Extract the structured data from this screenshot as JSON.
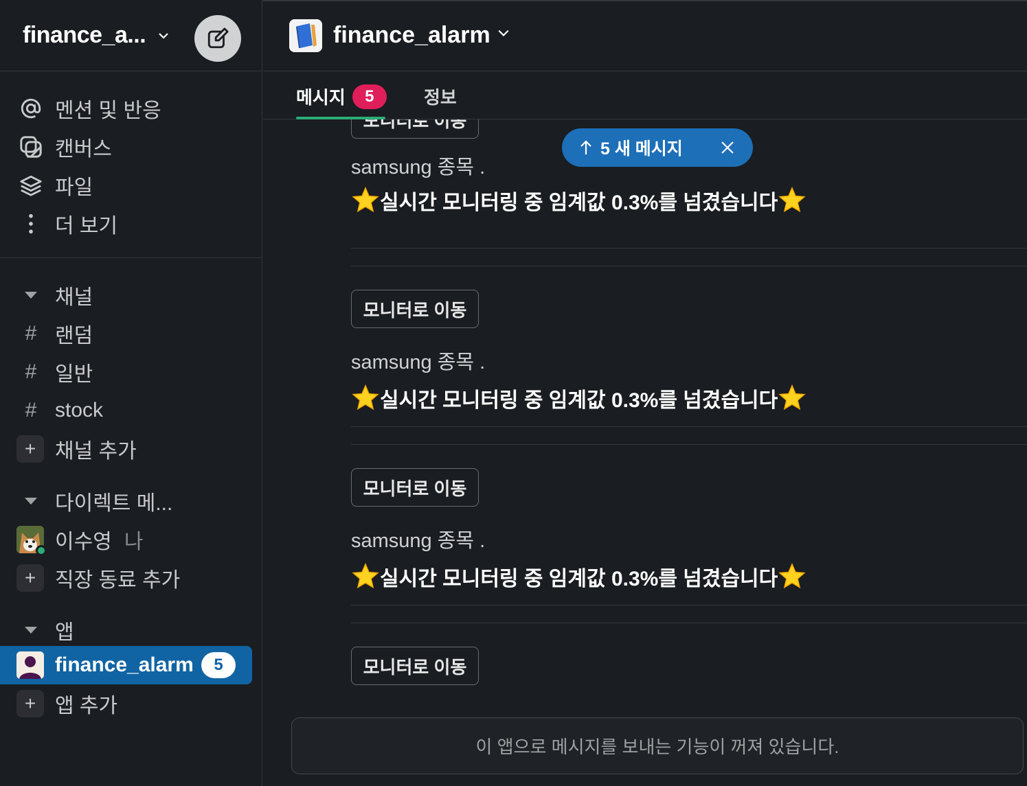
{
  "workspace": {
    "name": "finance_a..."
  },
  "nav": [
    {
      "label": "멘션 및 반응",
      "icon": "at-icon"
    },
    {
      "label": "캔버스",
      "icon": "canvas-icon"
    },
    {
      "label": "파일",
      "icon": "layers-icon"
    },
    {
      "label": "더 보기",
      "icon": "more-vertical-icon"
    }
  ],
  "channels_section": {
    "title": "채널",
    "channels": [
      "랜덤",
      "일반",
      "stock"
    ],
    "add_label": "채널 추가",
    "hash": "#"
  },
  "dm_section": {
    "title": "다이렉트 메...",
    "user": {
      "name": "이수영",
      "me_label": "나"
    },
    "add_label": "직장 동료 추가"
  },
  "apps_section": {
    "title": "앱",
    "active_app": {
      "name": "finance_alarm",
      "badge": "5"
    },
    "add_label": "앱 추가"
  },
  "channel": {
    "title": "finance_alarm",
    "tabs": [
      {
        "label": "메시지",
        "badge": "5"
      },
      {
        "label": "정보"
      }
    ]
  },
  "new_messages_pill": {
    "label": "5 새 메시지"
  },
  "messages": [
    {
      "button": "모니터로 이동",
      "line1": "samsung 종목  .",
      "line2": "실시간 모니터링 중 임계값 0.3%를 넘겼습니다"
    },
    {
      "button": "모니터로 이동",
      "line1": "samsung 종목  .",
      "line2": "실시간 모니터링 중 임계값 0.3%를 넘겼습니다"
    },
    {
      "button": "모니터로 이동",
      "line1": "samsung 종목  .",
      "line2": "실시간 모니터링 중 임계값 0.3%를 넘겼습니다"
    },
    {
      "button": "모니터로 이동"
    }
  ],
  "composer": {
    "disabled_text": "이 앱으로 메시지를 보내는 기능이 꺼져 있습니다."
  },
  "colors": {
    "active": "#1164a3",
    "badge": "#e01e5a",
    "presence": "#2bac76",
    "pill": "#1d6fb8"
  }
}
